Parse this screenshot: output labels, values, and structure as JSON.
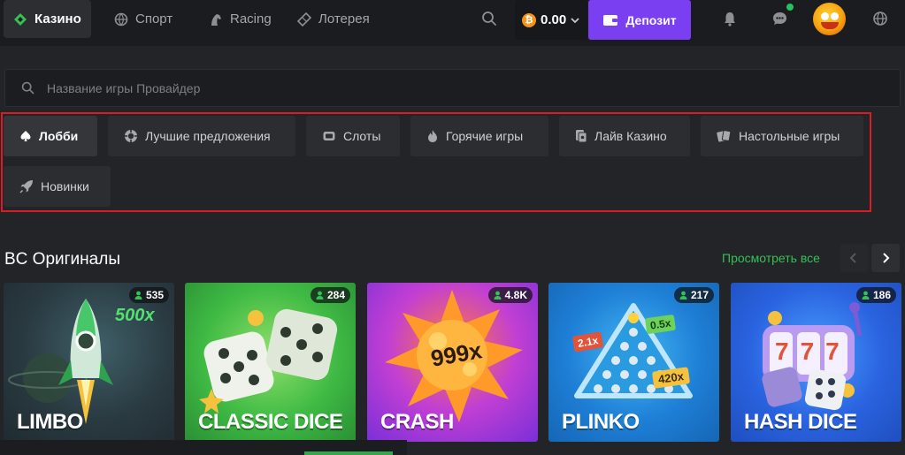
{
  "topnav": {
    "items": [
      {
        "label": "Казино",
        "icon": "casino-icon",
        "active": true
      },
      {
        "label": "Спорт",
        "icon": "sport-ball-icon"
      },
      {
        "label": "Racing",
        "icon": "horse-icon"
      },
      {
        "label": "Лотерея",
        "icon": "ticket-icon"
      }
    ],
    "balance": "0.00",
    "balance_currency_symbol": "₿",
    "deposit_label": "Депозит"
  },
  "search": {
    "placeholder": "Название игры Провайдер"
  },
  "categories": [
    {
      "label": "Лобби",
      "icon": "spade-icon",
      "active": true
    },
    {
      "label": "Лучшие предложения",
      "icon": "chip-icon"
    },
    {
      "label": "Слоты",
      "icon": "slot-icon"
    },
    {
      "label": "Горячие игры",
      "icon": "fire-icon"
    },
    {
      "label": "Лайв Казино",
      "icon": "live-cards-icon"
    },
    {
      "label": "Настольные игры",
      "icon": "table-cards-icon"
    },
    {
      "label": "Новинки",
      "icon": "rocket-icon"
    }
  ],
  "originals": {
    "title": "BC Оригиналы",
    "see_all": "Просмотреть все",
    "games": [
      {
        "title": "LIMBO",
        "players": "535",
        "extra": "500x"
      },
      {
        "title": "CLASSIC DICE",
        "players": "284"
      },
      {
        "title": "CRASH",
        "players": "4.8K",
        "extra": "999x"
      },
      {
        "title": "PLINKO",
        "players": "217",
        "multipliers": [
          "2.1x",
          "0.5x",
          "420x"
        ]
      },
      {
        "title": "HASH DICE",
        "players": "186",
        "reels": "777"
      }
    ]
  },
  "colors": {
    "accent": "#7b3ff2",
    "link": "#35c155",
    "highlight_box": "#d81e24",
    "bg": "#232427"
  }
}
